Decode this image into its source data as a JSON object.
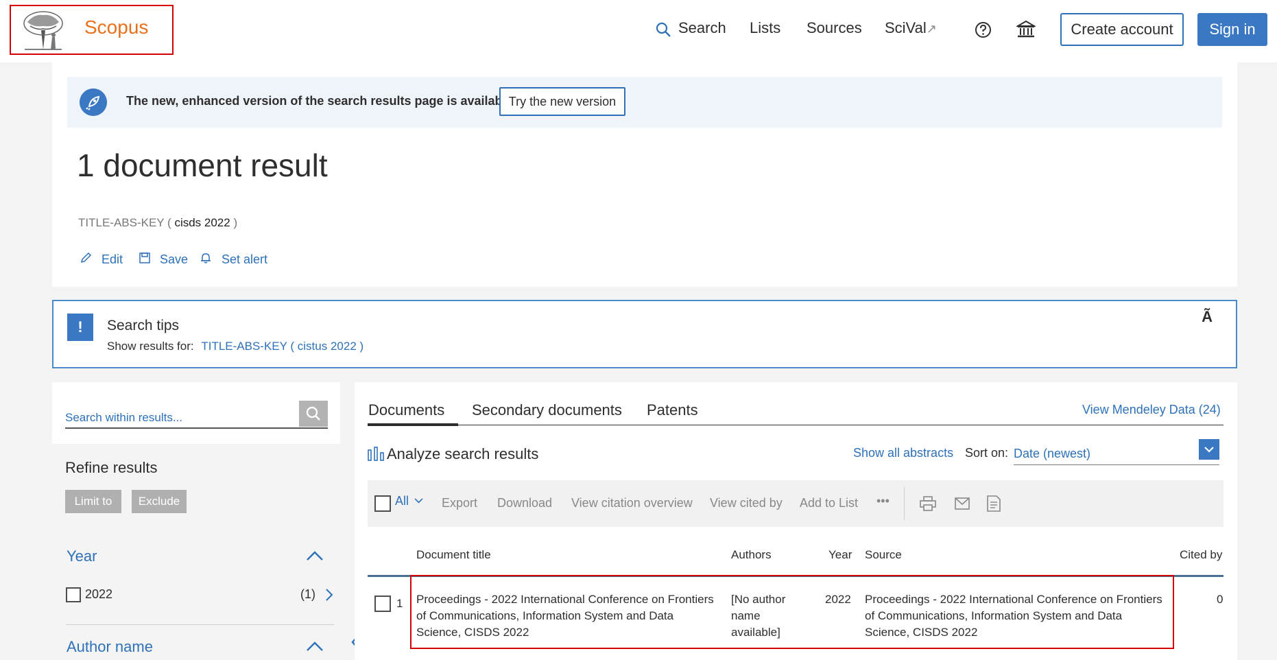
{
  "header": {
    "logo_text": "Scopus",
    "nav": {
      "search": "Search",
      "lists": "Lists",
      "sources": "Sources",
      "scival": "SciVal",
      "scival_arrow": "↗"
    },
    "create_account": "Create account",
    "sign_in": "Sign in"
  },
  "banner": {
    "text": "The new, enhanced version of the search results page is available.",
    "button": "Try the new version"
  },
  "results_header": {
    "count_text": "1 document result",
    "query_prefix": "TITLE-ABS-KEY (",
    "query_terms": " cisds  2022 ",
    "query_suffix": ")",
    "actions": {
      "edit": "Edit",
      "save": "Save",
      "set_alert": "Set alert"
    }
  },
  "search_tips": {
    "badge": "!",
    "title": "Search tips",
    "show_for_label": "Show results for:",
    "suggestion": "TITLE-ABS-KEY ( cistus  2022 )",
    "close": "Ã"
  },
  "refine": {
    "search_placeholder": "Search within results...",
    "title": "Refine results",
    "limit_to": "Limit to",
    "exclude": "Exclude",
    "facets": [
      {
        "title": "Year",
        "items": [
          {
            "label": "2022",
            "count": "(1)"
          }
        ]
      },
      {
        "title": "Author name"
      }
    ]
  },
  "tabs": {
    "documents": "Documents",
    "secondary": "Secondary documents",
    "patents": "Patents",
    "mendeley": "View Mendeley Data (24)"
  },
  "tools": {
    "analyze": "Analyze search results",
    "show_abstracts": "Show all abstracts",
    "sort_label": "Sort on:",
    "sort_value": "Date (newest)"
  },
  "toolbar": {
    "all": "All",
    "export": "Export",
    "download": "Download",
    "citation_overview": "View citation overview",
    "cited_by": "View cited by",
    "add_to_list": "Add to List",
    "more": "•••"
  },
  "table": {
    "columns": {
      "title": "Document title",
      "authors": "Authors",
      "year": "Year",
      "source": "Source",
      "cited_by": "Cited by"
    },
    "rows": [
      {
        "num": "1",
        "title": "Proceedings - 2022 International Conference on Frontiers of Communications, Information System and Data Science, CISDS 2022",
        "authors": "[No author name available]",
        "year": "2022",
        "source": "Proceedings - 2022 International Conference on Frontiers of Communications, Information System and Data Science, CISDS 2022",
        "cited_by": "0"
      }
    ]
  },
  "colors": {
    "brand_orange": "#e9711c",
    "link_blue": "#2e71b8",
    "primary_button": "#3a78c3",
    "highlight_red": "#d40000"
  }
}
